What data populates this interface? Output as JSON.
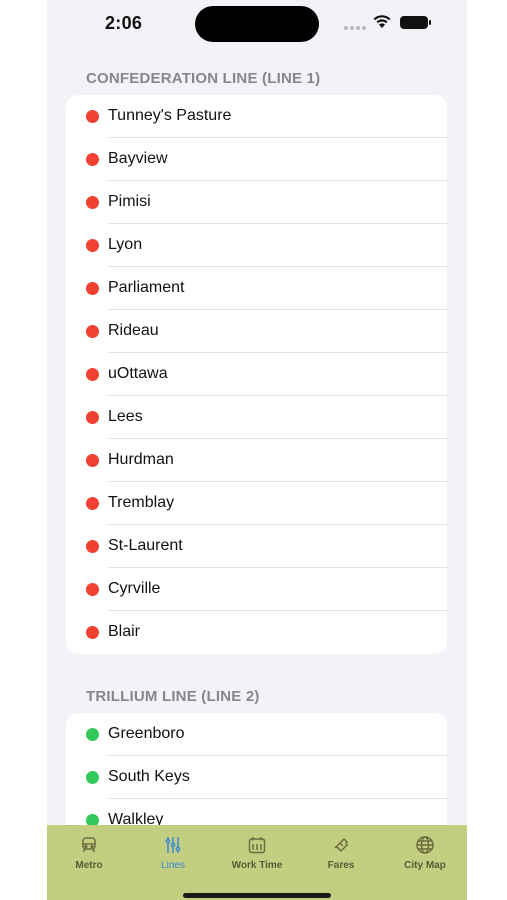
{
  "status": {
    "time": "2:06"
  },
  "colors": {
    "line1": "#f04133",
    "line2": "#34c759",
    "tab_active": "#3a86d9",
    "tab_bar": "#c3cf80"
  },
  "sections": [
    {
      "header": "CONFEDERATION LINE (LINE 1)",
      "color": "#f04133",
      "stations": [
        "Tunney's Pasture",
        "Bayview",
        "Pimisi",
        "Lyon",
        "Parliament",
        "Rideau",
        "uOttawa",
        "Lees",
        "Hurdman",
        "Tremblay",
        "St-Laurent",
        "Cyrville",
        "Blair"
      ]
    },
    {
      "header": "TRILLIUM LINE (LINE 2)",
      "color": "#34c759",
      "stations": [
        "Greenboro",
        "South Keys",
        "Walkley"
      ]
    }
  ],
  "tabs": [
    {
      "label": "Metro",
      "icon": "train-icon",
      "active": false
    },
    {
      "label": "Lines",
      "icon": "lines-icon",
      "active": true
    },
    {
      "label": "Work Time",
      "icon": "calendar-icon",
      "active": false
    },
    {
      "label": "Fares",
      "icon": "ticket-icon",
      "active": false
    },
    {
      "label": "City Map",
      "icon": "globe-icon",
      "active": false
    }
  ]
}
